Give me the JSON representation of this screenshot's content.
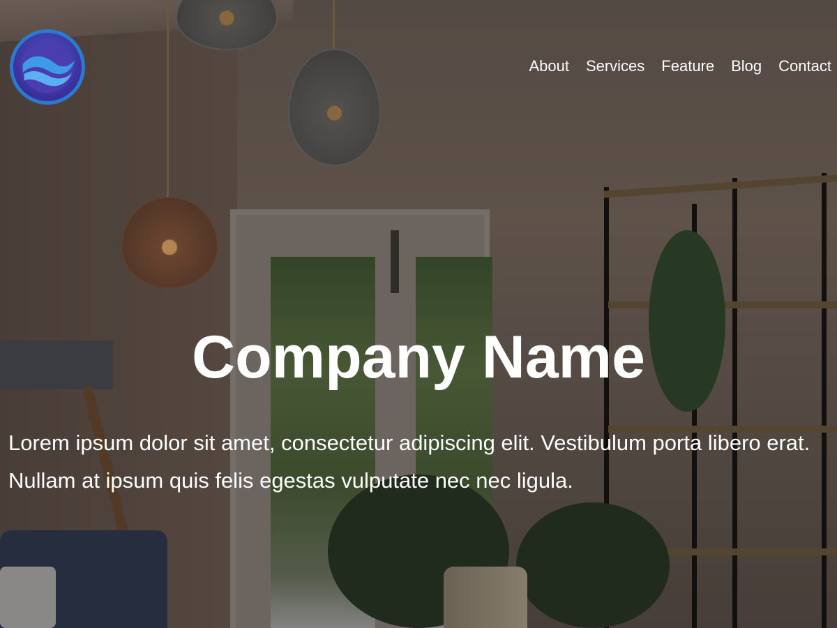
{
  "logo": {
    "icon": "wave-circle-logo",
    "colors": {
      "ring": "#2a7bcf",
      "fill": "#3a2f9a",
      "wave": "#3d9be9"
    }
  },
  "nav": {
    "items": [
      {
        "label": "About"
      },
      {
        "label": "Services"
      },
      {
        "label": "Feature"
      },
      {
        "label": "Blog"
      },
      {
        "label": "Contact"
      }
    ]
  },
  "hero": {
    "title": "Company Name",
    "description": "Lorem ipsum dolor sit amet, consectetur adipiscing elit. Vestibulum porta libero erat. Nullam at ipsum quis felis egestas vulputate nec nec ligula.",
    "text_color": "#ffffff"
  }
}
